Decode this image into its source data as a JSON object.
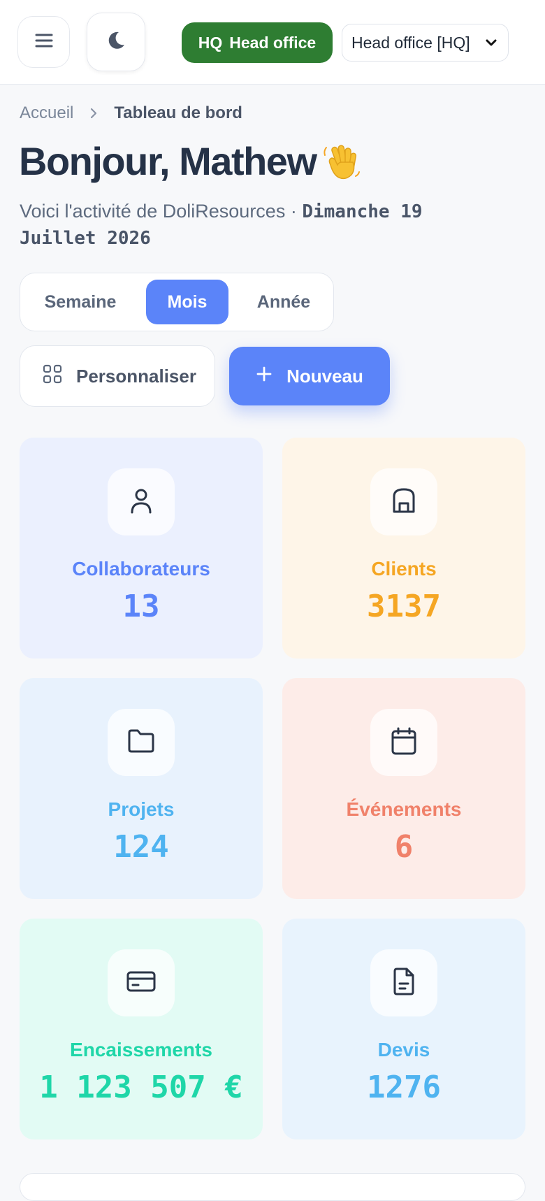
{
  "header": {
    "menu_icon": "hamburger-menu-icon",
    "theme_icon": "moon-icon",
    "hq_badge": {
      "code": "HQ",
      "name": "Head office",
      "color": "#2e7d32"
    },
    "entity_select": {
      "value": "Head office [HQ]"
    }
  },
  "breadcrumb": {
    "home": "Accueil",
    "current": "Tableau de bord"
  },
  "greeting": {
    "title": "Bonjour, Mathew",
    "emoji_icon": "waving-hand-icon"
  },
  "subtitle": {
    "text": "Voici l'activité de DoliResources · ",
    "date": "Dimanche 19 Juillet 2026"
  },
  "period_tabs": [
    {
      "label": "Semaine",
      "active": false
    },
    {
      "label": "Mois",
      "active": true
    },
    {
      "label": "Année",
      "active": false
    }
  ],
  "actions": {
    "customize_label": "Personnaliser",
    "new_label": "Nouveau"
  },
  "accent_color": "#5b84f9",
  "stats": [
    {
      "label": "Collaborateurs",
      "value": "13",
      "icon": "user-icon",
      "color": "#5b84f9",
      "bg": "#ebf0fe"
    },
    {
      "label": "Clients",
      "value": "3137",
      "icon": "building-icon",
      "color": "#f5a623",
      "bg": "#fef5e8"
    },
    {
      "label": "Projets",
      "value": "124",
      "icon": "folder-icon",
      "color": "#4fb3f0",
      "bg": "#e8f2fd"
    },
    {
      "label": "Événements",
      "value": "6",
      "icon": "calendar-icon",
      "color": "#f0816a",
      "bg": "#fdece8"
    },
    {
      "label": "Encaissements",
      "value": "1 123 507 €",
      "icon": "credit-card-icon",
      "color": "#1fd6a8",
      "bg": "#e2fbf4"
    },
    {
      "label": "Devis",
      "value": "1276",
      "icon": "document-icon",
      "color": "#4fb3f0",
      "bg": "#e8f3fd"
    }
  ]
}
